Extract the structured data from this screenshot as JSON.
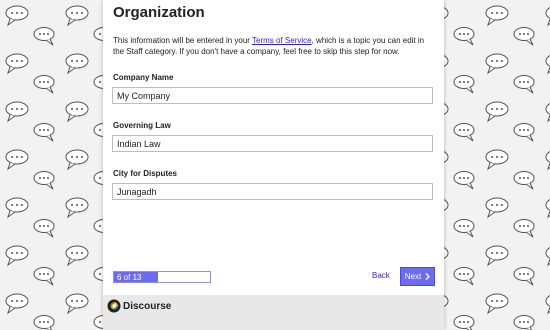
{
  "page": {
    "title": "Organization",
    "intro_before": "This information will be entered in your ",
    "intro_link": "Terms of Service",
    "intro_after": ", which is a topic you can edit in the Staff category. If you don't have a company, feel free to skip this step for now."
  },
  "fields": [
    {
      "label": "Company Name",
      "value": "My Company"
    },
    {
      "label": "Governing Law",
      "value": "Indian Law"
    },
    {
      "label": "City for Disputes",
      "value": "Junagadh"
    }
  ],
  "progress": {
    "text": "6 of 13",
    "fraction": 0.4615
  },
  "nav": {
    "back_label": "Back",
    "next_label": "Next",
    "next_icon": "chevron-right-icon"
  },
  "footer": {
    "logo_text": "Discourse"
  },
  "colors": {
    "accent": "#6c6cf2",
    "link": "#2d1fd0",
    "background": "#f2f2f2"
  }
}
